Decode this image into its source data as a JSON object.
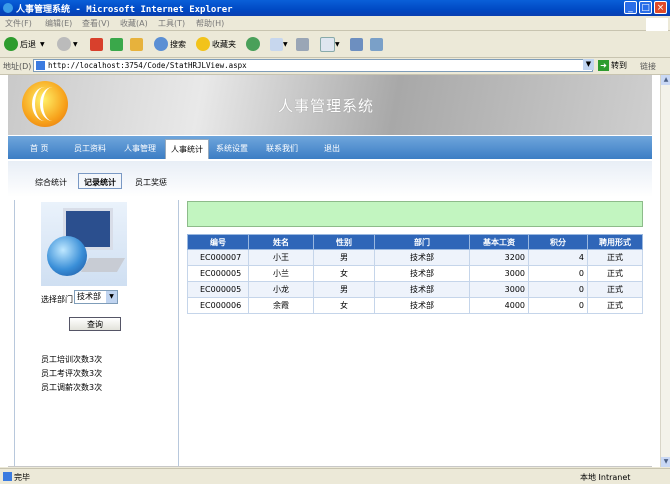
{
  "window": {
    "title": "人事管理系统 - Microsoft Internet Explorer"
  },
  "menubar": [
    "文件(F)",
    "编辑(E)",
    "查看(V)",
    "收藏(A)",
    "工具(T)",
    "帮助(H)"
  ],
  "toolbar": {
    "back": "后退",
    "search": "搜索",
    "favorites": "收藏夹"
  },
  "address": {
    "label": "地址(D)",
    "url": "http://localhost:3754/Code/StatHRJLView.aspx",
    "go": "转到",
    "links": "链接"
  },
  "banner": {
    "title": "人事管理系统"
  },
  "nav": [
    "首 页",
    "员工资料",
    "人事管理",
    "人事统计",
    "系统设置",
    "联系我们",
    "退出"
  ],
  "subnav": [
    "综合统计",
    "记录统计",
    "员工奖惩"
  ],
  "sidebar": {
    "dept_label": "选择部门",
    "dept_value": "技术部",
    "query_button": "查询",
    "stats": [
      "员工培训次数3次",
      "员工考评次数3次",
      "员工调薪次数3次"
    ]
  },
  "table": {
    "headers": [
      "编号",
      "姓名",
      "性别",
      "部门",
      "基本工资",
      "积分",
      "聘用形式"
    ],
    "rows": [
      [
        "EC000007",
        "小王",
        "男",
        "技术部",
        "3200",
        "4",
        "正式"
      ],
      [
        "EC000005",
        "小兰",
        "女",
        "技术部",
        "3000",
        "0",
        "正式"
      ],
      [
        "EC000005",
        "小龙",
        "男",
        "技术部",
        "3000",
        "0",
        "正式"
      ],
      [
        "EC000006",
        "余霞",
        "女",
        "技术部",
        "4000",
        "0",
        "正式"
      ]
    ]
  },
  "status": {
    "text": "完毕",
    "zone": "本地 Intranet"
  },
  "colors": {
    "nav": "#3c7dc4",
    "header_row": "#2f66b8",
    "message_box": "#c2f5c0"
  }
}
